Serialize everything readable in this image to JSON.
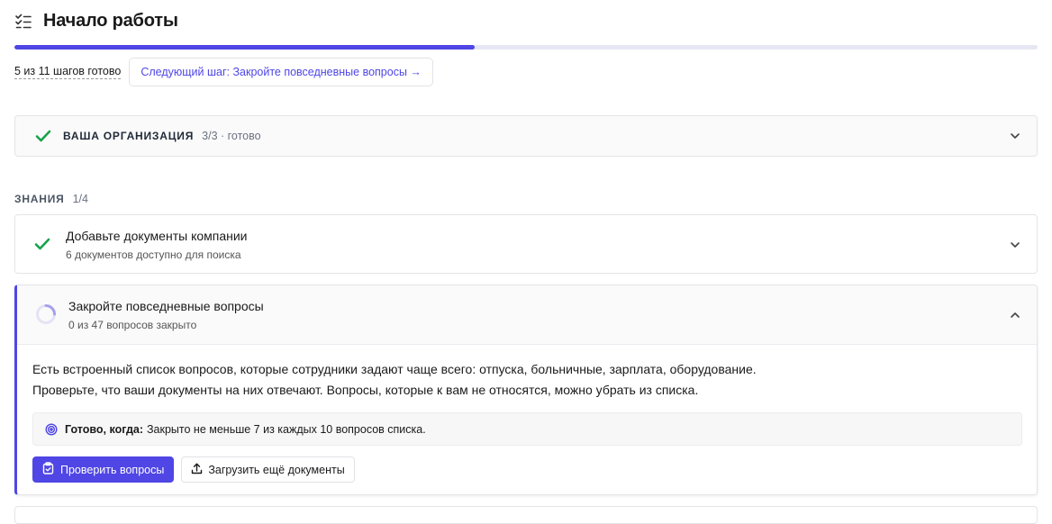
{
  "header": {
    "title": "Начало работы",
    "icon": "checklist-icon"
  },
  "progress": {
    "completed": 5,
    "total": 11,
    "fraction": 0.45
  },
  "status": {
    "steps_done": "5 из 11 шагов готово",
    "next_step": "Следующий шаг: Закройте повседневные вопросы →"
  },
  "org_section": {
    "title": "ВАША ОРГАНИЗАЦИЯ",
    "meta": "3/3 · готово",
    "icon": "check-icon"
  },
  "knowledge": {
    "label": "ЗНАНИЯ",
    "count": "1/4",
    "tasks": [
      {
        "title": "Добавьте документы компании",
        "subtitle": "6 документов доступно для поиска",
        "status": "done"
      },
      {
        "title": "Закройте повседневные вопросы",
        "subtitle": "0 из 47 вопросов закрыто",
        "status": "in-progress",
        "description_line1": "Есть встроенный список вопросов, которые сотрудники задают чаще всего: отпуска, больничные, зарплата, оборудование.",
        "description_line2": "Проверьте, что ваши документы на них отвечают. Вопросы, которые к вам не относятся, можно убрать из списка.",
        "done_when_label": "Готово, когда:",
        "done_when_text": "Закрыто не меньше 7 из каждых 10 вопросов списка.",
        "primary_action": "Проверить вопросы",
        "secondary_action": "Загрузить ещё документы"
      }
    ]
  },
  "colors": {
    "accent": "#4f46e5",
    "success": "#16a34a"
  }
}
